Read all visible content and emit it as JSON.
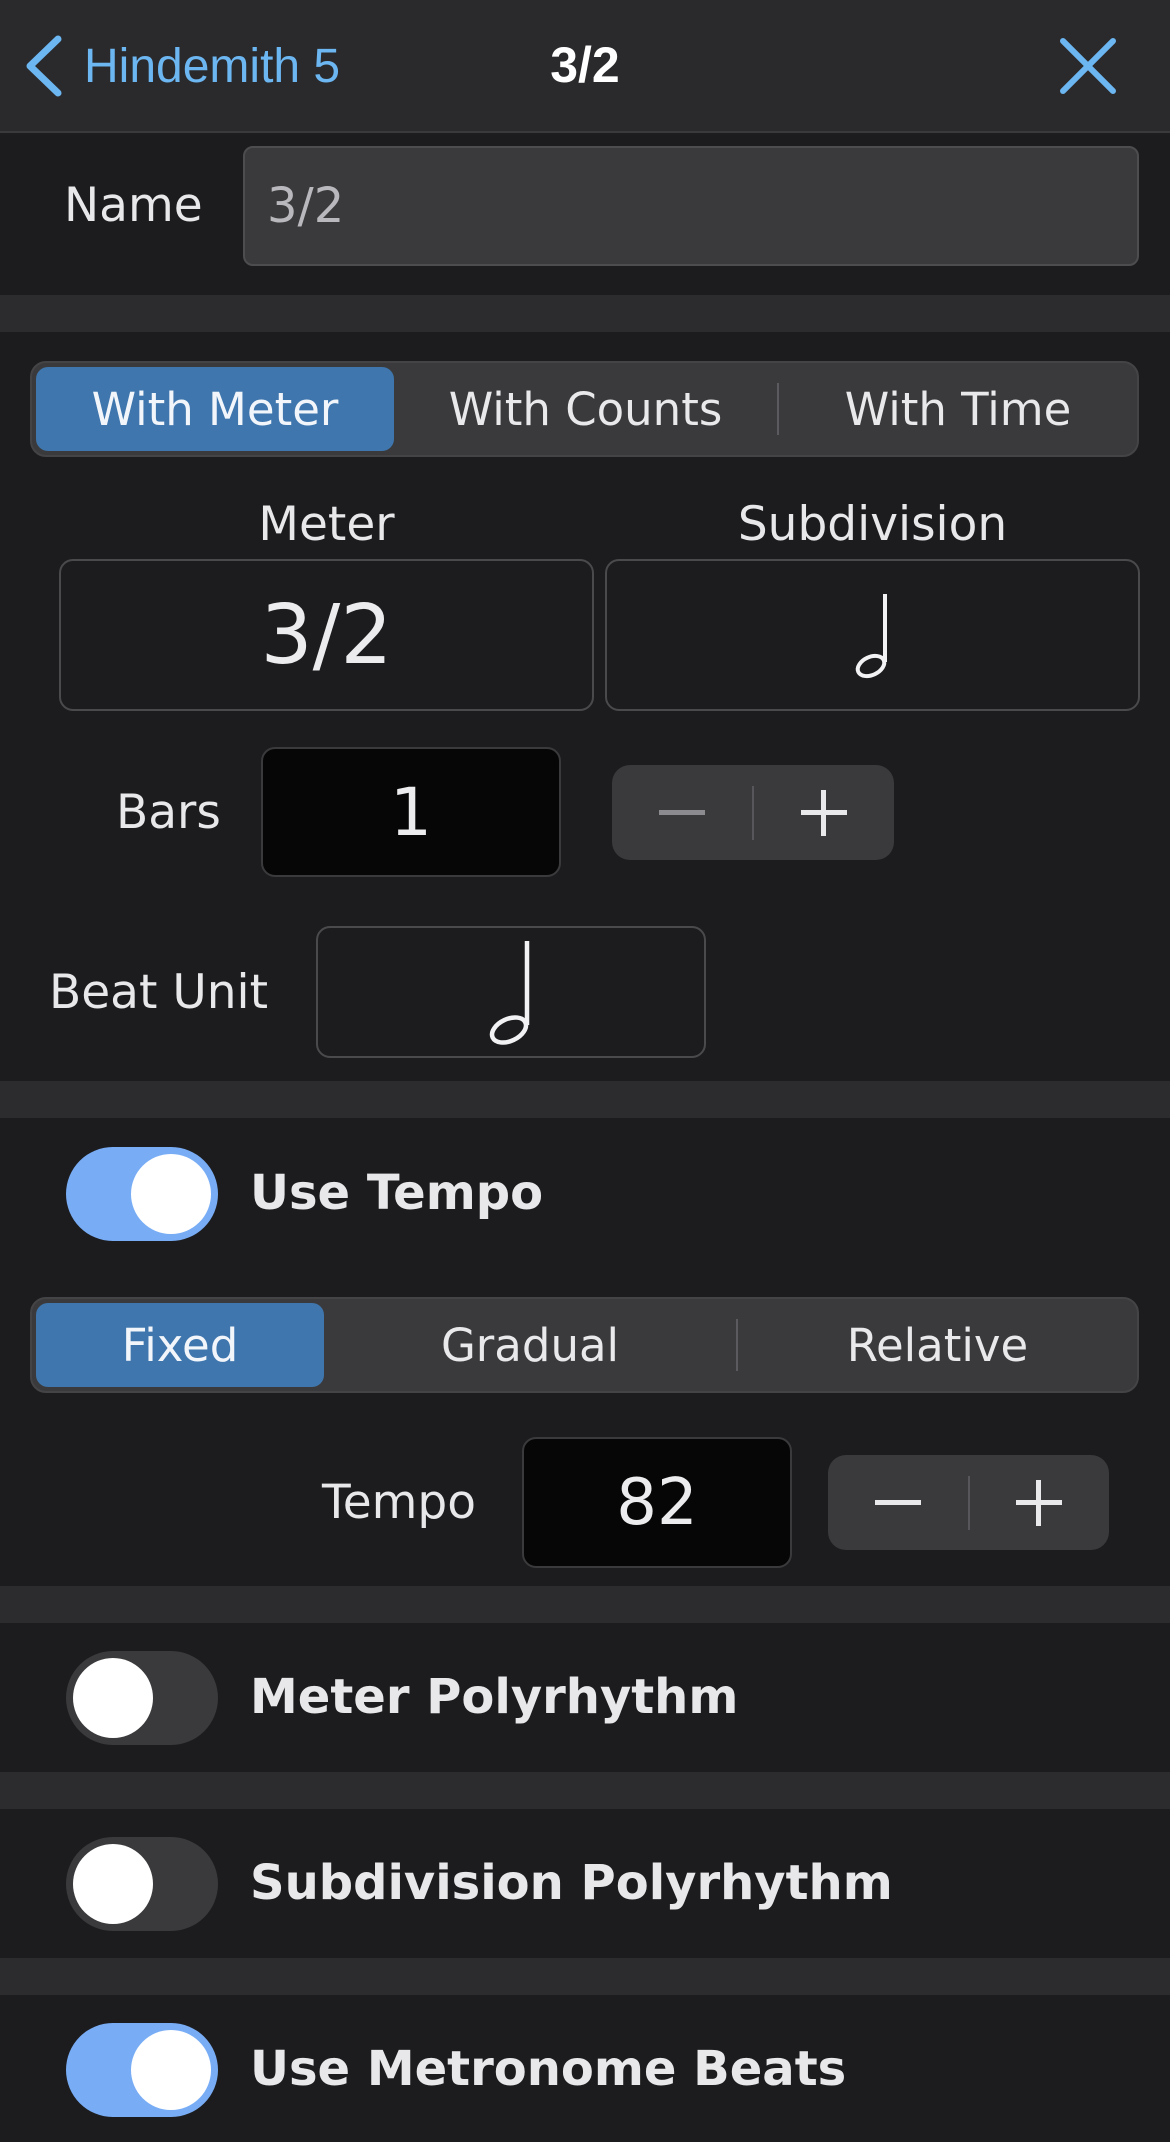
{
  "header": {
    "back_label": "Hindemith 5",
    "title": "3/2"
  },
  "name_row": {
    "label": "Name",
    "value": "3/2"
  },
  "mode_segment": {
    "items": [
      "With Meter",
      "With Counts",
      "With Time"
    ],
    "selected": "With Meter"
  },
  "meter": {
    "label": "Meter",
    "value": "3/2"
  },
  "subdivision": {
    "label": "Subdivision",
    "icon": "half-note-icon"
  },
  "bars": {
    "label": "Bars",
    "value": "1"
  },
  "beat_unit": {
    "label": "Beat Unit",
    "icon": "half-note-icon"
  },
  "use_tempo": {
    "label": "Use Tempo",
    "on": true
  },
  "tempo_segment": {
    "items": [
      "Fixed",
      "Gradual",
      "Relative"
    ],
    "selected": "Fixed"
  },
  "tempo": {
    "label": "Tempo",
    "value": "82"
  },
  "meter_polyrhythm": {
    "label": "Meter Polyrhythm",
    "on": false
  },
  "subdivision_polyrhythm": {
    "label": "Subdivision Polyrhythm",
    "on": false
  },
  "use_metronome_beats": {
    "label": "Use Metronome Beats",
    "on": true
  },
  "colors": {
    "accent": "#6cb6f2",
    "segment_active": "#3f76ad",
    "toggle_on": "#78adf6"
  }
}
